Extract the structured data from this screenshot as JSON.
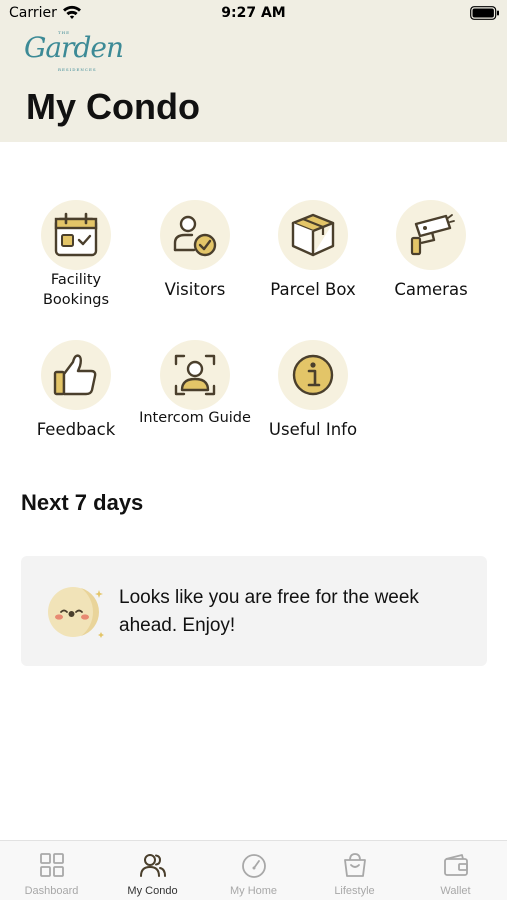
{
  "status_bar": {
    "carrier": "Carrier",
    "time": "9:27 AM"
  },
  "header": {
    "logo_small_top": "THE",
    "logo_script": "Garden",
    "logo_small_bottom": "RESIDENCES",
    "title": "My Condo"
  },
  "tiles": [
    {
      "label": "Facility Bookings",
      "icon": "calendar-icon"
    },
    {
      "label": "Visitors",
      "icon": "visitor-check-icon"
    },
    {
      "label": "Parcel Box",
      "icon": "parcel-box-icon"
    },
    {
      "label": "Cameras",
      "icon": "security-camera-icon"
    },
    {
      "label": "Feedback",
      "icon": "thumbs-up-icon"
    },
    {
      "label": "Intercom Guide",
      "icon": "intercom-face-icon"
    },
    {
      "label": "Useful Info",
      "icon": "info-icon"
    }
  ],
  "next_days": {
    "title": "Next 7 days",
    "empty_message": "Looks like you are free for the week ahead. Enjoy!"
  },
  "tabbar": {
    "items": [
      {
        "label": "Dashboard",
        "icon": "grid-icon",
        "active": false
      },
      {
        "label": "My Condo",
        "icon": "people-icon",
        "active": true
      },
      {
        "label": "My Home",
        "icon": "gauge-icon",
        "active": false
      },
      {
        "label": "Lifestyle",
        "icon": "shopping-bag-icon",
        "active": false
      },
      {
        "label": "Wallet",
        "icon": "wallet-icon",
        "active": false
      }
    ]
  },
  "colors": {
    "header_bg": "#f0eee3",
    "accent_gold": "#e3c568",
    "icon_stroke": "#4a3f2c",
    "logo_teal": "#3c8a96"
  }
}
